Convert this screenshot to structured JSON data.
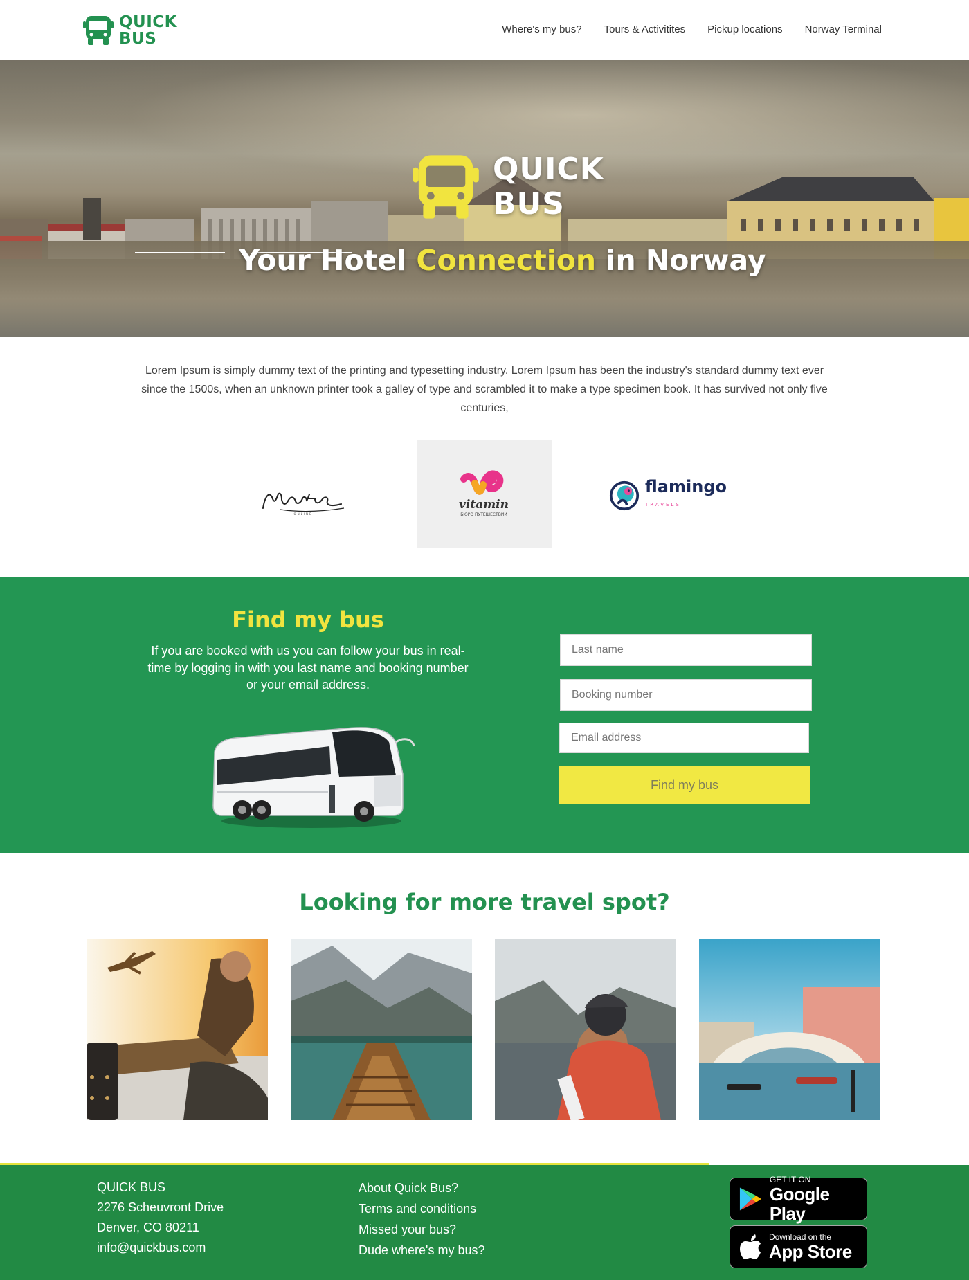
{
  "header": {
    "logo_text": "QUICK BUS",
    "nav": [
      {
        "label": "Where's my bus?"
      },
      {
        "label": "Tours & Activitites"
      },
      {
        "label": "Pickup locations"
      },
      {
        "label": "Norway Terminal"
      }
    ]
  },
  "hero": {
    "logo_line1": "QUICK",
    "logo_line2": "BUS",
    "title_pre": "Your Hotel ",
    "title_highlight": "Connection",
    "title_post": " in Norway"
  },
  "intro": {
    "text": "Lorem Ipsum is simply dummy text of the printing and typesetting industry. Lorem Ipsum has been the industry's standard dummy text ever since the 1500s, when an unknown printer took a galley of type and scrambled it to make a type specimen book. It has survived not only five centuries,"
  },
  "partners": [
    {
      "name": "Monte",
      "sub": "ONLINE"
    },
    {
      "name": "vitamin",
      "sub": "БЮРО ПУТЕШЕСТВИЙ"
    },
    {
      "name": "flamingo",
      "sub": "TRAVELS"
    }
  ],
  "find_bus": {
    "title": "Find my bus",
    "text": "If you are booked with us you can follow your bus in real-time by logging in with you last name and booking number or your email address.",
    "last_name_placeholder": "Last name",
    "booking_placeholder": "Booking number",
    "email_placeholder": "Email address",
    "button_label": "Find my bus"
  },
  "spots": {
    "title": "Looking for more travel spot?"
  },
  "footer": {
    "company": "QUICK BUS",
    "address1": "2276 Scheuvront Drive",
    "address2": "Denver, CO 80211",
    "email": "info@quickbus.com",
    "links": [
      {
        "label": "About Quick Bus?"
      },
      {
        "label": "Terms and conditions"
      },
      {
        "label": "Missed your bus?"
      },
      {
        "label": "Dude where's my bus?"
      }
    ],
    "google_play": {
      "small": "GET IT ON",
      "big": "Google Play"
    },
    "app_store": {
      "small": "Download on the",
      "big": "App Store"
    }
  },
  "colors": {
    "brand_green": "#239150",
    "section_green": "#239653",
    "footer_green": "#228a44",
    "accent_yellow": "#f1e43f"
  }
}
